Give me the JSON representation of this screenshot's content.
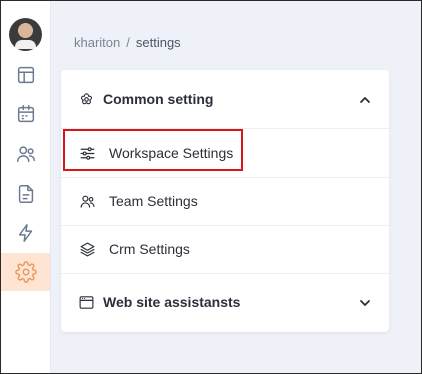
{
  "breadcrumb": {
    "parent": "khariton",
    "separator": "/",
    "current": "settings"
  },
  "sidebar": {
    "items": [
      {
        "name": "dashboard",
        "icon": "layout-icon",
        "active": false
      },
      {
        "name": "calendar",
        "icon": "calendar-icon",
        "active": false
      },
      {
        "name": "users",
        "icon": "users-icon",
        "active": false
      },
      {
        "name": "documents",
        "icon": "document-icon",
        "active": false
      },
      {
        "name": "automation",
        "icon": "lightning-icon",
        "active": false
      },
      {
        "name": "settings",
        "icon": "gear-icon",
        "active": true
      }
    ]
  },
  "settings": {
    "common": {
      "title": "Common setting",
      "icon": "flower-icon",
      "expanded": true,
      "items": [
        {
          "label": "Workspace Settings",
          "icon": "sliders-icon",
          "highlighted": true
        },
        {
          "label": "Team Settings",
          "icon": "users-icon"
        },
        {
          "label": "Crm Settings",
          "icon": "layers-icon"
        }
      ]
    },
    "web": {
      "title": "Web site assistansts",
      "icon": "browser-icon",
      "expanded": false
    }
  },
  "colors": {
    "accent": "#e9995e",
    "active_bg": "#fde4d3",
    "highlight_border": "#d9141b",
    "page_bg": "#eef1f7"
  }
}
